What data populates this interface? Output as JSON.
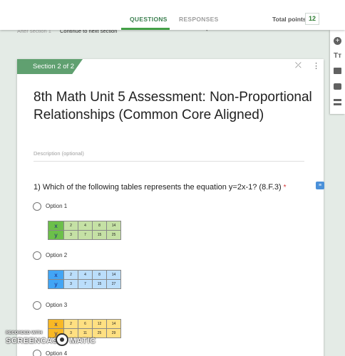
{
  "header": {
    "tabs": [
      {
        "label": "QUESTIONS",
        "active": true
      },
      {
        "label": "RESPONSES",
        "active": false
      }
    ],
    "total_points_label": "Total points:",
    "total_points_value": "12"
  },
  "after_section": {
    "label": "After section 1",
    "value": "Continue to next section"
  },
  "section": {
    "badge": "Section 2 of 2",
    "title": "8th Math Unit 5 Assessment: Non-Proportional Relationships (Common Core Aligned)",
    "description_placeholder": "Description (optional)"
  },
  "question": {
    "text": "1) Which of the following tables represents the equation y=2x-1?  (8.F.3)",
    "required_mark": "*",
    "options": [
      {
        "label": "Option 1",
        "table": {
          "x_label": "x",
          "y_label": "y",
          "x": [
            "2",
            "4",
            "8",
            "14"
          ],
          "y": [
            "3",
            "7",
            "15",
            "25"
          ],
          "color": "#6cbf4a"
        }
      },
      {
        "label": "Option 2",
        "table": {
          "x_label": "x",
          "y_label": "y",
          "x": [
            "2",
            "4",
            "8",
            "14"
          ],
          "y": [
            "3",
            "7",
            "15",
            "27"
          ],
          "color": "#42a5f5"
        }
      },
      {
        "label": "Option 3",
        "table": {
          "x_label": "x",
          "y_label": "y",
          "x": [
            "2",
            "6",
            "12",
            "14"
          ],
          "y": [
            "3",
            "11",
            "25",
            "29"
          ],
          "color": "#f9b824"
        }
      },
      {
        "label": "Option 4"
      }
    ]
  },
  "sidebar": {
    "icons": [
      "add-question-icon",
      "add-title-icon",
      "add-image-icon",
      "add-video-icon",
      "add-section-icon"
    ]
  },
  "watermark": {
    "recorded_with": "RECORDED WITH",
    "brand_left": "SCREENCAST",
    "brand_right": "MATIC"
  },
  "colors": {
    "accent": "#43a047",
    "section_badge": "#60a070",
    "background": "#e4ebe6"
  }
}
